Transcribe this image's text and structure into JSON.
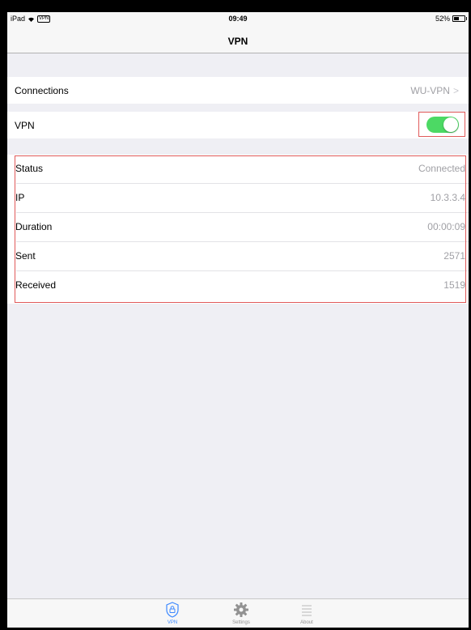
{
  "status_bar": {
    "device": "iPad",
    "vpn_badge": "VPN",
    "time": "09:49",
    "battery": "52%",
    "battery_level": 0.52
  },
  "nav": {
    "title": "VPN"
  },
  "connections": {
    "label": "Connections",
    "value": "WU-VPN",
    "chevron": ">"
  },
  "vpn_toggle": {
    "label": "VPN",
    "on": true,
    "on_color": "#4cd964"
  },
  "info": {
    "rows": [
      {
        "label": "Status",
        "value": "Connected"
      },
      {
        "label": "IP",
        "value": "10.3.3.4"
      },
      {
        "label": "Duration",
        "value": "00:00:09"
      },
      {
        "label": "Sent",
        "value": "2571"
      },
      {
        "label": "Received",
        "value": "1519"
      }
    ]
  },
  "tabs": [
    {
      "label": "VPN",
      "icon": "shield-lock-icon",
      "active": true
    },
    {
      "label": "Settings",
      "icon": "gear-icon",
      "active": false
    },
    {
      "label": "About",
      "icon": "list-icon",
      "active": false
    }
  ],
  "colors": {
    "accent": "#3c88ff",
    "highlight": "#e05a5a"
  }
}
